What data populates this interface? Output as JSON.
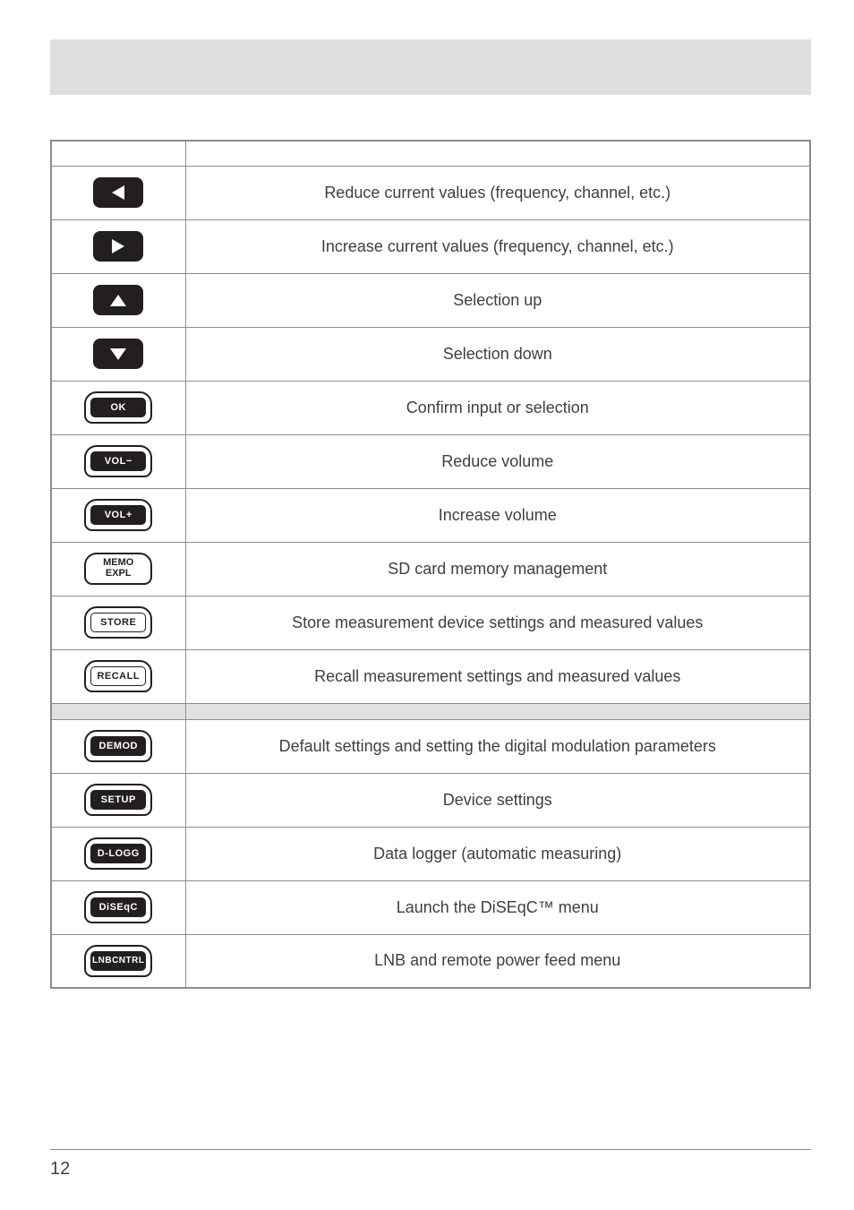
{
  "rows": [
    {
      "key": "left",
      "desc": "Reduce current values (frequency, channel, etc.)"
    },
    {
      "key": "right",
      "desc": "Increase current values (frequency, channel, etc.)"
    },
    {
      "key": "up",
      "desc": "Selection up"
    },
    {
      "key": "down",
      "desc": "Selection down"
    },
    {
      "key": "ok",
      "desc": "Confirm input or selection",
      "label": "OK"
    },
    {
      "key": "volm",
      "desc": "Reduce volume",
      "label": "VOL−"
    },
    {
      "key": "volp",
      "desc": "Increase volume",
      "label": "VOL+"
    },
    {
      "key": "memo",
      "desc": "SD card memory management",
      "line1": "MEMO",
      "line2": "EXPL"
    },
    {
      "key": "store",
      "desc": "Store measurement device settings and measured values",
      "label": "STORE"
    },
    {
      "key": "recall",
      "desc": "Recall measurement settings and measured values",
      "label": "RECALL"
    },
    {
      "key": "demod",
      "desc": "Default settings and setting the digital modulation parameters",
      "label": "DEMOD"
    },
    {
      "key": "setup",
      "desc": "Device settings",
      "label": "SETUP"
    },
    {
      "key": "dlogg",
      "desc": "Data logger (automatic measuring)",
      "label": "D-LOGG"
    },
    {
      "key": "diseqc",
      "desc": "Launch the DiSEqC™ menu",
      "label": "DiSEqC"
    },
    {
      "key": "lnb",
      "desc": "LNB and remote power feed menu",
      "line1": "LNB",
      "line2": "CNTRL"
    }
  ],
  "page_number": "12"
}
